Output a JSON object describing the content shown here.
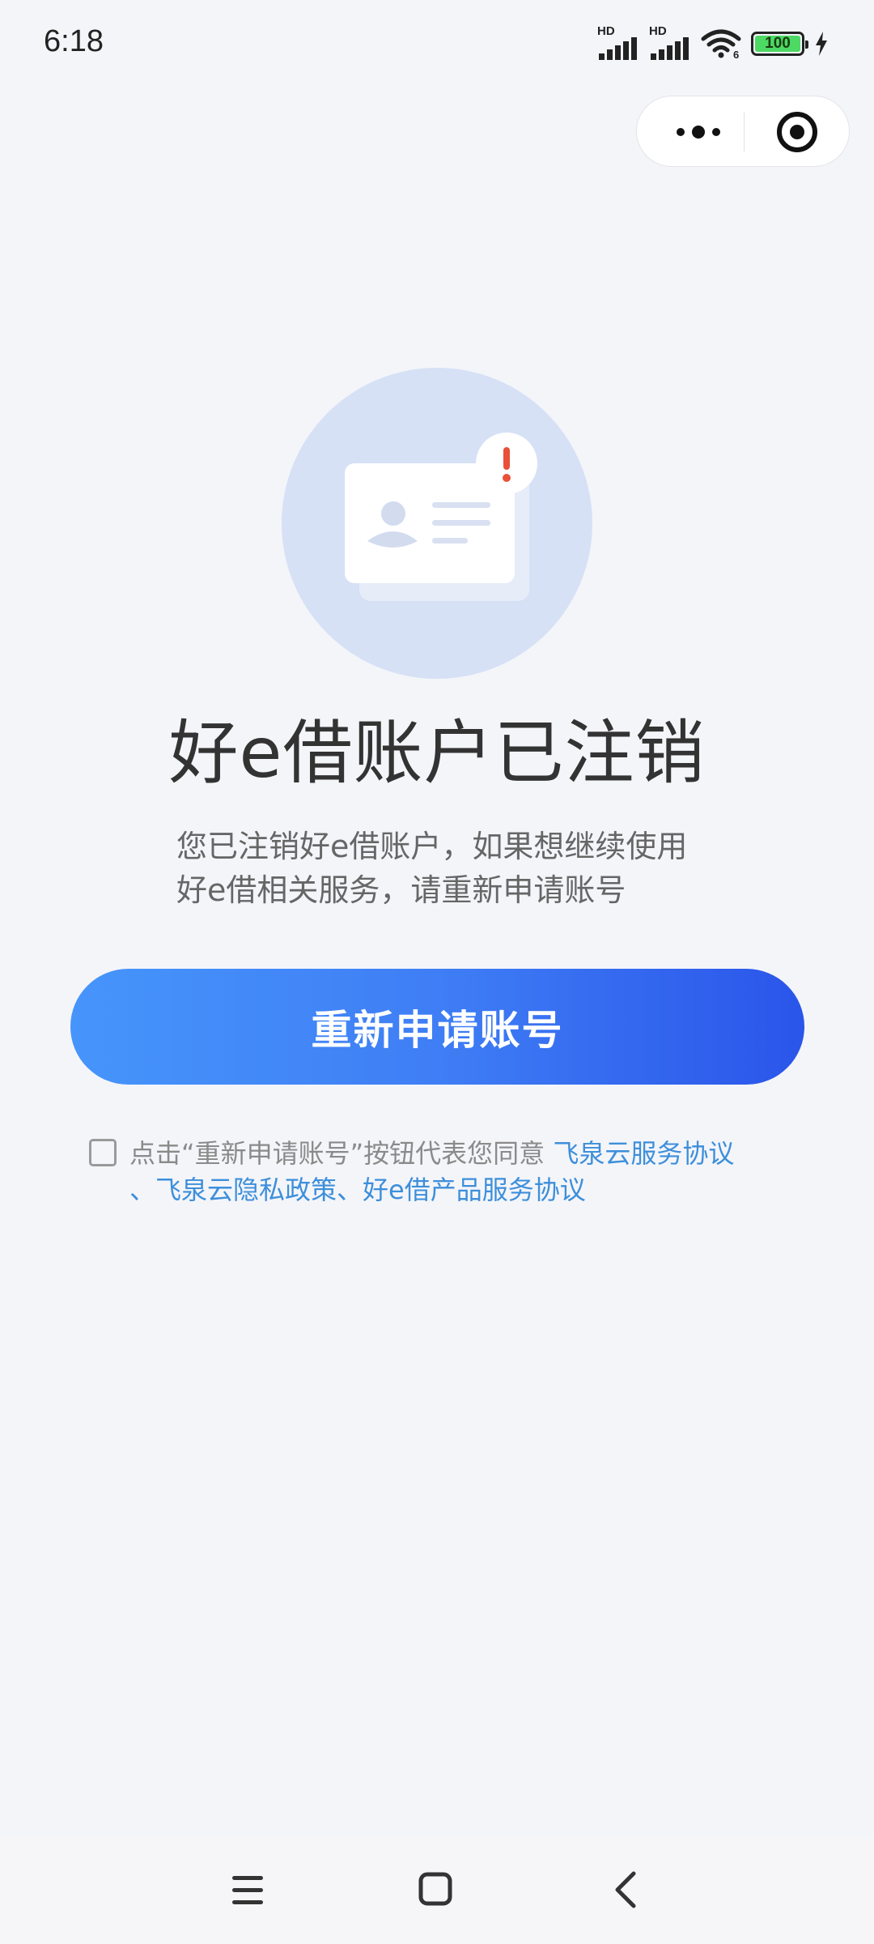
{
  "status_bar": {
    "time": "6:18",
    "network_1": "HD",
    "network_2": "HD",
    "battery": "100"
  },
  "capsule": {
    "more_icon": "more-dots-icon",
    "close_icon": "target-close-icon"
  },
  "illustration": {
    "icon": "account-cancelled-id-card-icon",
    "alert_mark": "!"
  },
  "title": "好e借账户已注销",
  "description": {
    "line1": "您已注销好e借账户，如果想继续使用",
    "line2": "好e借相关服务，请重新申请账号"
  },
  "main_button": {
    "label": "重新申请账号"
  },
  "agreement": {
    "checked": false,
    "prefix": "点击“重新申请账号”按钮代表您同意 ",
    "link1": "飞泉云服务协议",
    "link2": "、飞泉云隐私政策、好e借产品服务协议"
  },
  "nav_bar": {
    "menu_icon": "menu-icon",
    "home_icon": "home-square-icon",
    "back_icon": "back-chevron-icon"
  },
  "colors": {
    "background": "#F4F5F9",
    "button_gradient_start": "#4695FB",
    "button_gradient_end": "#2A55EA",
    "link": "#3D8FDB",
    "alert": "#E8503A",
    "illustration_circle": "#D6E1F6"
  }
}
